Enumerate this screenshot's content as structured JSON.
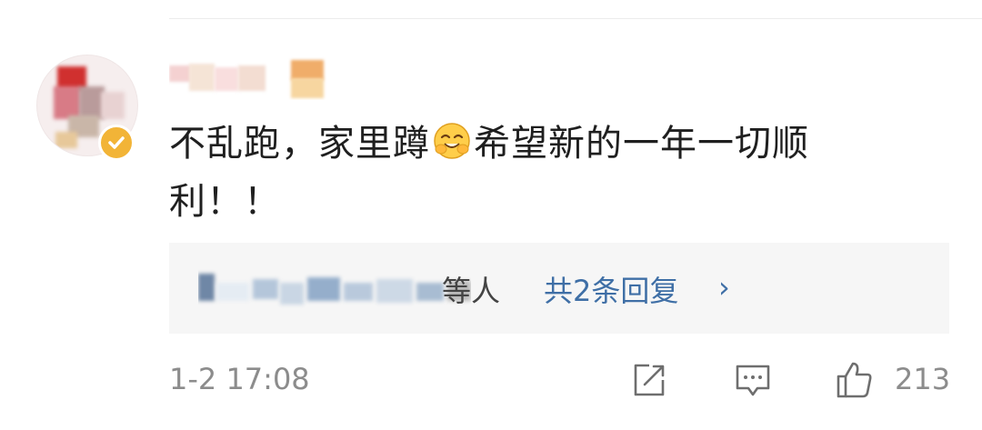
{
  "comment": {
    "text_part1": "不乱跑，家里蹲",
    "emoji": "smiling-face-with-hands-emoji",
    "text_part2": "希望新的一年一切顺利！！"
  },
  "replies": {
    "suffix": "等人",
    "count_label": "共2条回复",
    "chevron": "›"
  },
  "footer": {
    "timestamp": "1-2 17:08",
    "like_count": "213"
  },
  "icons": {
    "share": "share-icon",
    "comment": "comment-icon",
    "like": "thumbs-up-icon"
  },
  "colors": {
    "text": "#1f1f1f",
    "link": "#3f6fa6",
    "meta": "#8c8c8c",
    "reply_bg": "#f6f6f6",
    "badge": "#f2b437"
  }
}
